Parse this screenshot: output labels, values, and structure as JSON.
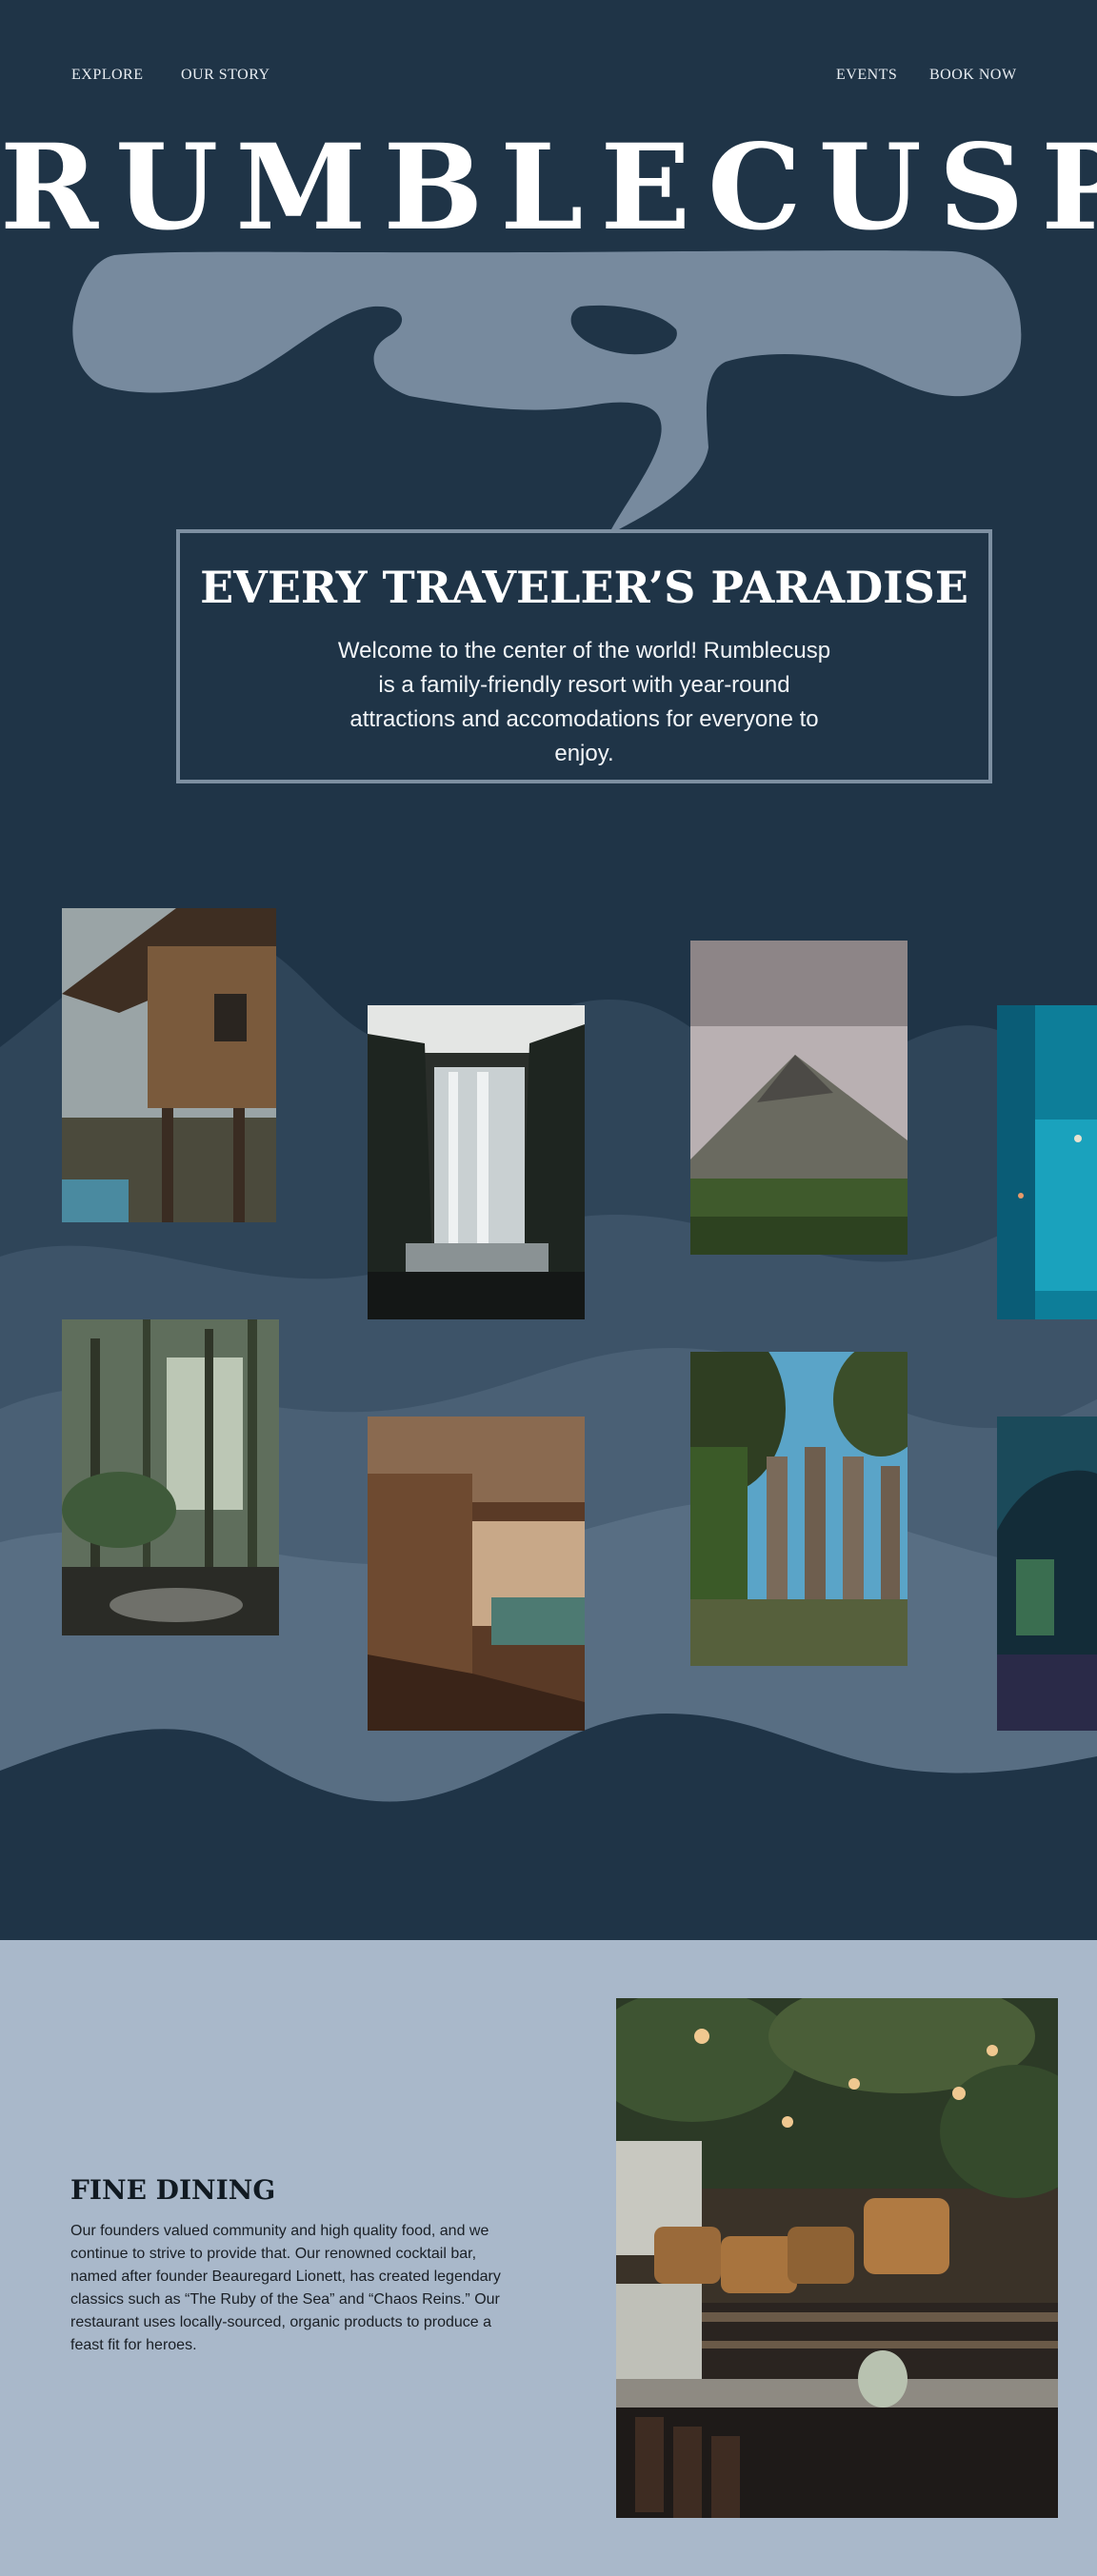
{
  "nav": {
    "explore": "EXPLORE",
    "our_story": "OUR STORY",
    "events": "EVENTS",
    "book_now": "BOOK NOW"
  },
  "brand": {
    "name": "RUMBLECUSP"
  },
  "intro": {
    "title": "EVERY TRAVELER’S PARADISE",
    "text": "Welcome to the center of the world! Rumblecusp is a family-friendly resort with year-round attractions and accomodations for everyone to enjoy."
  },
  "gallery": {
    "photos": [
      "treehouse-photo",
      "waterfall-photo",
      "volcano-photo",
      "lagoon-photo",
      "jungle-photo",
      "cave-photo",
      "ruins-photo",
      "aquarium-photo"
    ]
  },
  "dining": {
    "title": "FINE DINING",
    "text": "Our founders valued community and high quality food, and we continue to strive to provide that. Our renowned cocktail bar, named after founder Beauregard Lionett, has created legendary classics such as “The Ruby of the Sea” and “Chaos Reins.” Our restaurant uses locally-sourced, organic products to produce a feast fit for heroes."
  },
  "colors": {
    "background": "#1f3447",
    "blob": "#778a9e",
    "dining_background": "#a9b8ca"
  }
}
